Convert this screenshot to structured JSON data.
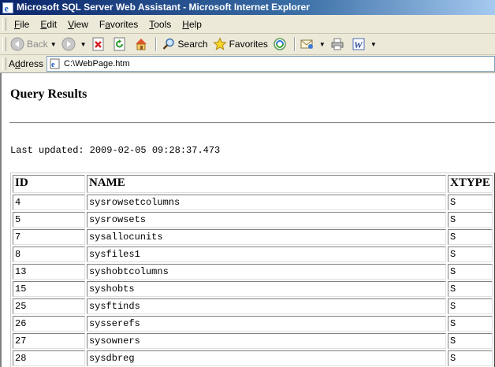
{
  "window": {
    "title": "Microsoft SQL Server Web Assistant - Microsoft Internet Explorer",
    "icon": "ie-icon"
  },
  "menu": {
    "items": [
      {
        "pre": "",
        "u": "F",
        "post": "ile"
      },
      {
        "pre": "",
        "u": "E",
        "post": "dit"
      },
      {
        "pre": "",
        "u": "V",
        "post": "iew"
      },
      {
        "pre": "F",
        "u": "a",
        "post": "vorites"
      },
      {
        "pre": "",
        "u": "T",
        "post": "ools"
      },
      {
        "pre": "",
        "u": "H",
        "post": "elp"
      }
    ]
  },
  "toolbar": {
    "back_label": "Back",
    "search_label": "Search",
    "favorites_label": "Favorites"
  },
  "address": {
    "label_pre": "A",
    "label_u": "d",
    "label_post": "dress",
    "value": "C:\\WebPage.htm"
  },
  "page": {
    "title": "Query Results",
    "updated_label": "Last updated:",
    "updated_value": "2009-02-05 09:28:37.473"
  },
  "table": {
    "headers": [
      "ID",
      "NAME",
      "XTYPE"
    ],
    "rows": [
      [
        "4",
        "sysrowsetcolumns",
        "S"
      ],
      [
        "5",
        "sysrowsets",
        "S"
      ],
      [
        "7",
        "sysallocunits",
        "S"
      ],
      [
        "8",
        "sysfiles1",
        "S"
      ],
      [
        "13",
        "syshobtcolumns",
        "S"
      ],
      [
        "15",
        "syshobts",
        "S"
      ],
      [
        "25",
        "sysftinds",
        "S"
      ],
      [
        "26",
        "sysserefs",
        "S"
      ],
      [
        "27",
        "sysowners",
        "S"
      ],
      [
        "28",
        "sysdbreg",
        "S"
      ]
    ]
  },
  "colors": {
    "titlebar_start": "#0a246a",
    "chrome": "#ece9d8"
  }
}
